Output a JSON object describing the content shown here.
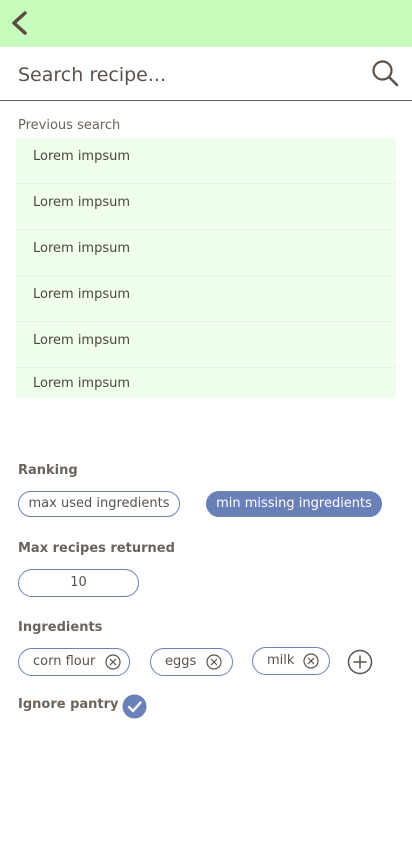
{
  "search": {
    "placeholder": "Search recipe..."
  },
  "previous_search": {
    "label": "Previous search",
    "items": [
      "Lorem impsum",
      "Lorem impsum",
      "Lorem impsum",
      "Lorem impsum",
      "Lorem impsum",
      "Lorem impsum"
    ]
  },
  "ranking": {
    "label": "Ranking",
    "options": [
      "max used ingredients",
      "min missing ingredients"
    ],
    "selected": "min missing ingredients"
  },
  "max_recipes": {
    "label": "Max recipes returned",
    "value": "10"
  },
  "ingredients": {
    "label": "Ingredients",
    "items": [
      "corn flour",
      "eggs",
      "milk"
    ]
  },
  "ignore_pantry": {
    "label": "Ignore pantry",
    "checked": true
  },
  "colors": {
    "header_bg": "#c6fcbc",
    "list_bg": "#efffec",
    "accent": "#6a80b8",
    "text": "#5b524b"
  },
  "icons": {
    "back": "chevron-left-icon",
    "search": "magnifier-icon",
    "remove": "circle-x-icon",
    "add": "circle-plus-icon",
    "check": "check-circle-icon"
  }
}
